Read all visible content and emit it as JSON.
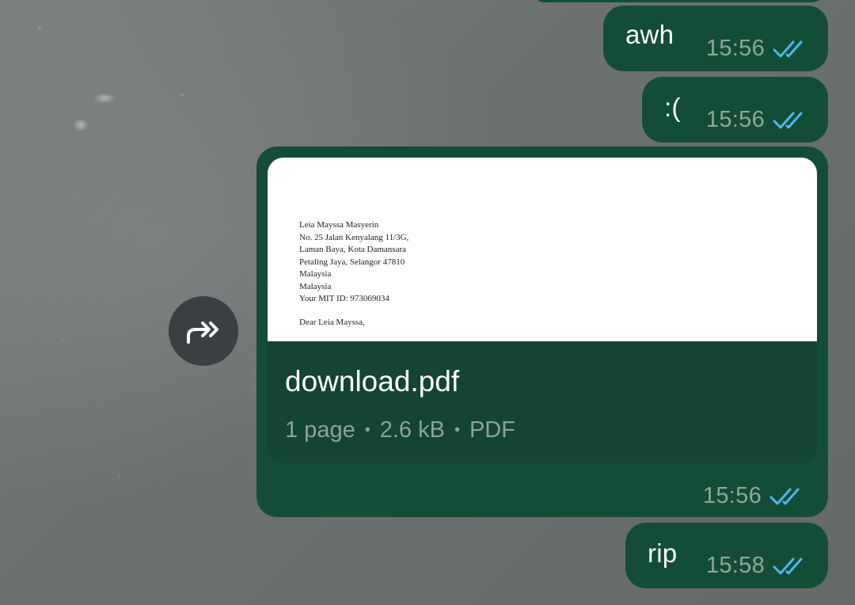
{
  "messages": [
    {
      "text": "awh",
      "time": "15:56",
      "status": "read"
    },
    {
      "text": ":(",
      "time": "15:56",
      "status": "read"
    },
    {
      "document": {
        "filename": "download.pdf",
        "pages": "1 page",
        "size": "2.6 kB",
        "type": "PDF",
        "preview_lines": [
          "Leia Mayssa Masyerin",
          "No. 25 Jalan Kenyalang 11/3G,",
          "Laman Baya, Kota Damansara",
          "Petaling Jaya, Selangor 47810",
          "Malaysia",
          "Malaysia",
          "Your MIT ID: 973069034",
          "Dear Leia Mayssa,"
        ]
      },
      "time": "15:56",
      "status": "read"
    },
    {
      "text": "rip",
      "time": "15:58",
      "status": "read"
    }
  ],
  "icons": {
    "read_ticks": "double-check-icon",
    "forward": "forward-share-icon"
  },
  "colors": {
    "bubble": "#134d37",
    "doc_info": "#134434",
    "ticks": "#4fb6ec",
    "meta_text": "#8fa79b",
    "forward_button": "#3a3f42"
  }
}
